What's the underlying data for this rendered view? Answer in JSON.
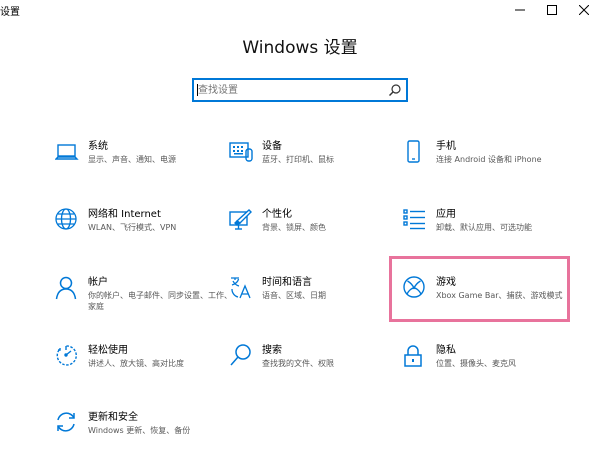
{
  "window": {
    "title": "设置"
  },
  "header": {
    "title": "Windows 设置"
  },
  "search": {
    "placeholder": "查找设置",
    "value": ""
  },
  "tiles": [
    {
      "name": "系统",
      "desc": "显示、声音、通知、电源",
      "icon": "laptop-icon"
    },
    {
      "name": "设备",
      "desc": "蓝牙、打印机、鼠标",
      "icon": "keyboard-icon"
    },
    {
      "name": "手机",
      "desc": "连接 Android 设备和 iPhone",
      "icon": "phone-icon"
    },
    {
      "name": "网络和 Internet",
      "desc": "WLAN、飞行模式、VPN",
      "icon": "globe-icon"
    },
    {
      "name": "个性化",
      "desc": "背景、锁屏、颜色",
      "icon": "brush-icon"
    },
    {
      "name": "应用",
      "desc": "卸载、默认应用、可选功能",
      "icon": "list-icon"
    },
    {
      "name": "帐户",
      "desc": "你的帐户、电子邮件、同步设置、工作、家庭",
      "icon": "person-icon"
    },
    {
      "name": "时间和语言",
      "desc": "语音、区域、日期",
      "icon": "time-language-icon"
    },
    {
      "name": "游戏",
      "desc": "Xbox Game Bar、捕获、游戏模式",
      "icon": "xbox-icon"
    },
    {
      "name": "轻松使用",
      "desc": "讲述人、放大镜、高对比度",
      "icon": "ease-of-access-icon"
    },
    {
      "name": "搜索",
      "desc": "查找我的文件、权限",
      "icon": "magnifier-icon"
    },
    {
      "name": "隐私",
      "desc": "位置、摄像头、麦克风",
      "icon": "lock-icon"
    },
    {
      "name": "更新和安全",
      "desc": "Windows 更新、恢复、备份",
      "icon": "refresh-icon"
    }
  ],
  "colors": {
    "accent": "#0078d7",
    "highlight": "#e8739c"
  }
}
